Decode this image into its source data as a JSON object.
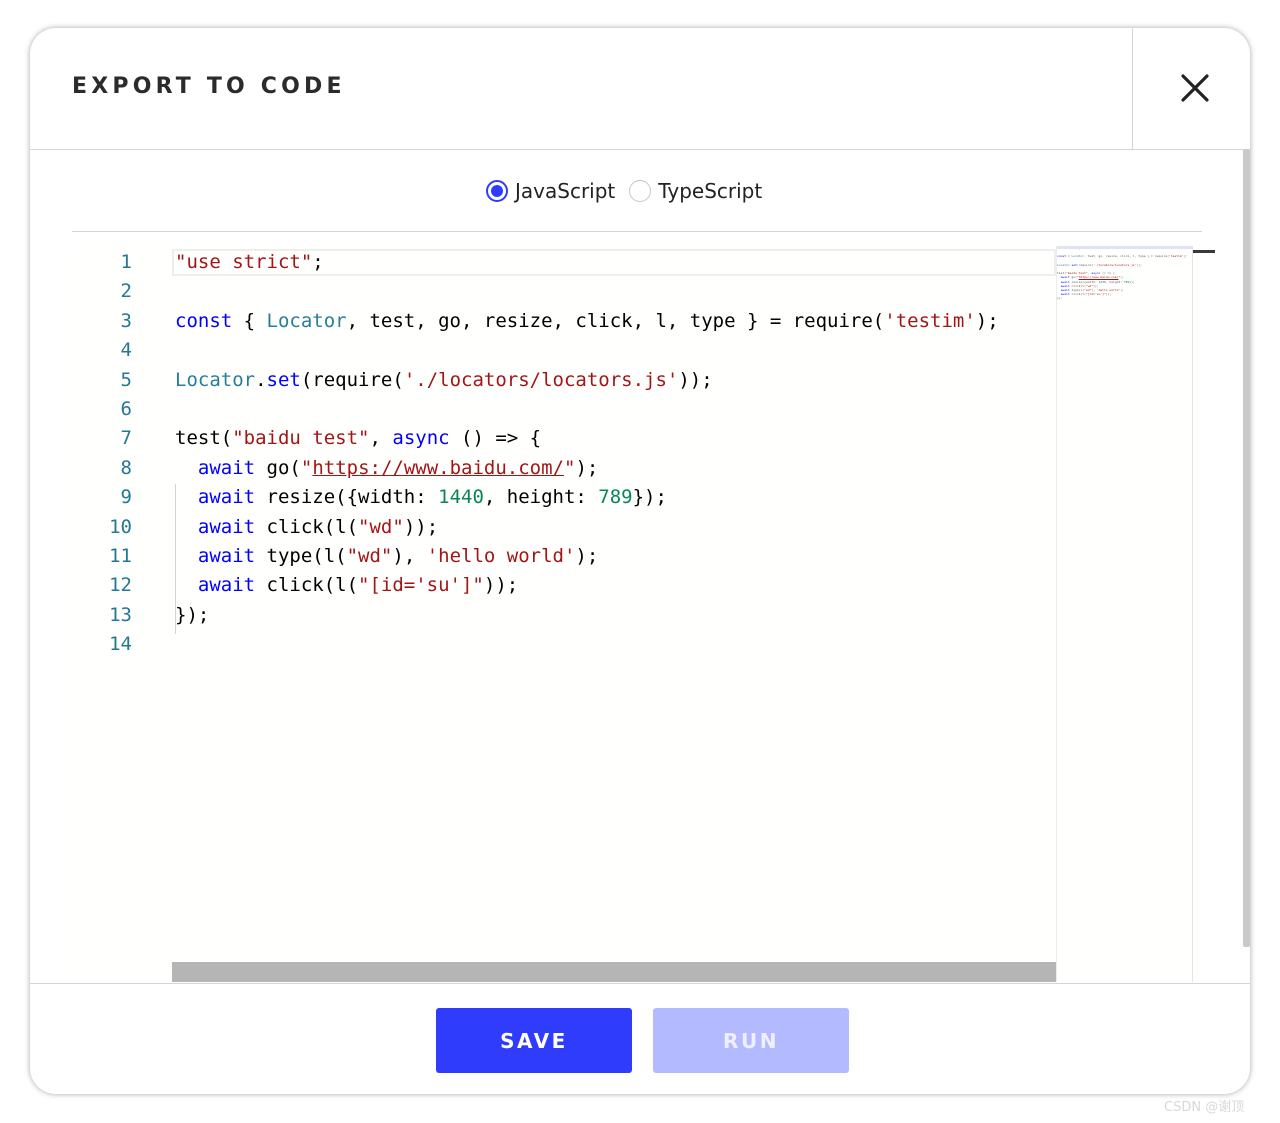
{
  "dialog": {
    "title": "EXPORT TO CODE",
    "close_icon": "close-icon"
  },
  "language": {
    "options": [
      {
        "label": "JavaScript",
        "selected": true
      },
      {
        "label": "TypeScript",
        "selected": false
      }
    ]
  },
  "editor": {
    "line_numbers": [
      "1",
      "2",
      "3",
      "4",
      "5",
      "6",
      "7",
      "8",
      "9",
      "10",
      "11",
      "12",
      "13",
      "14"
    ],
    "lines": [
      [
        {
          "t": "\"use strict\"",
          "c": "str"
        },
        {
          "t": ";",
          "c": ""
        }
      ],
      [],
      [
        {
          "t": "const",
          "c": "kw"
        },
        {
          "t": " { ",
          "c": ""
        },
        {
          "t": "Locator",
          "c": "tp"
        },
        {
          "t": ", test, go, resize, click, l, type } = require(",
          "c": ""
        },
        {
          "t": "'testim'",
          "c": "str"
        },
        {
          "t": ");",
          "c": ""
        }
      ],
      [],
      [
        {
          "t": "Locator",
          "c": "tp"
        },
        {
          "t": ".",
          "c": ""
        },
        {
          "t": "set",
          "c": "kw"
        },
        {
          "t": "(require(",
          "c": ""
        },
        {
          "t": "'./locators/locators.js'",
          "c": "str"
        },
        {
          "t": "));",
          "c": ""
        }
      ],
      [],
      [
        {
          "t": "test(",
          "c": ""
        },
        {
          "t": "\"baidu test\"",
          "c": "str"
        },
        {
          "t": ", ",
          "c": ""
        },
        {
          "t": "async",
          "c": "kw"
        },
        {
          "t": " () => {",
          "c": ""
        }
      ],
      [
        {
          "t": "  ",
          "c": ""
        },
        {
          "t": "await",
          "c": "kw"
        },
        {
          "t": " go(",
          "c": ""
        },
        {
          "t": "\"",
          "c": "str"
        },
        {
          "t": "https://www.baidu.com/",
          "c": "str link"
        },
        {
          "t": "\"",
          "c": "str"
        },
        {
          "t": ");",
          "c": ""
        }
      ],
      [
        {
          "t": "  ",
          "c": ""
        },
        {
          "t": "await",
          "c": "kw"
        },
        {
          "t": " resize({width: ",
          "c": ""
        },
        {
          "t": "1440",
          "c": "num"
        },
        {
          "t": ", height: ",
          "c": ""
        },
        {
          "t": "789",
          "c": "num"
        },
        {
          "t": "});",
          "c": ""
        }
      ],
      [
        {
          "t": "  ",
          "c": ""
        },
        {
          "t": "await",
          "c": "kw"
        },
        {
          "t": " click(l(",
          "c": ""
        },
        {
          "t": "\"wd\"",
          "c": "str"
        },
        {
          "t": "));",
          "c": ""
        }
      ],
      [
        {
          "t": "  ",
          "c": ""
        },
        {
          "t": "await",
          "c": "kw"
        },
        {
          "t": " type(l(",
          "c": ""
        },
        {
          "t": "\"wd\"",
          "c": "str"
        },
        {
          "t": "), ",
          "c": ""
        },
        {
          "t": "'hello world'",
          "c": "str"
        },
        {
          "t": ");",
          "c": ""
        }
      ],
      [
        {
          "t": "  ",
          "c": ""
        },
        {
          "t": "await",
          "c": "kw"
        },
        {
          "t": " click(l(",
          "c": ""
        },
        {
          "t": "\"[id='su']\"",
          "c": "str"
        },
        {
          "t": "));",
          "c": ""
        }
      ],
      [
        {
          "t": "});",
          "c": ""
        }
      ],
      []
    ]
  },
  "footer": {
    "save_label": "SAVE",
    "run_label": "RUN"
  },
  "watermark": "CSDN @谢顶"
}
